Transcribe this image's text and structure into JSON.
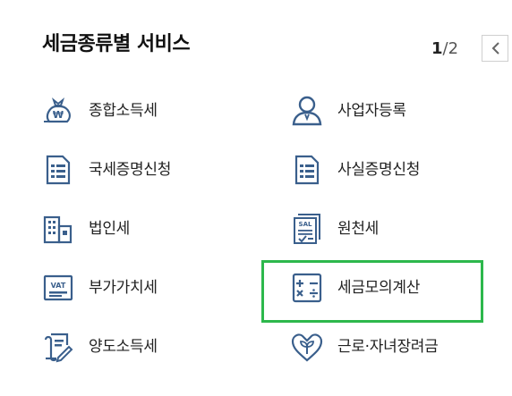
{
  "header": {
    "title": "세금종류별 서비스",
    "pager": {
      "current": "1",
      "separator": "/",
      "total": "2"
    }
  },
  "services": {
    "left": [
      {
        "label": "종합소득세",
        "icon": "money-bag-icon"
      },
      {
        "label": "국세증명신청",
        "icon": "document-icon"
      },
      {
        "label": "법인세",
        "icon": "building-icon"
      },
      {
        "label": "부가가치세",
        "icon": "vat-icon"
      },
      {
        "label": "양도소득세",
        "icon": "document-pen-icon"
      }
    ],
    "right": [
      {
        "label": "사업자등록",
        "icon": "person-icon"
      },
      {
        "label": "사실증명신청",
        "icon": "document-icon"
      },
      {
        "label": "원천세",
        "icon": "salary-slip-icon"
      },
      {
        "label": "세금모의계산",
        "icon": "calculator-icon"
      },
      {
        "label": "근로·자녀장려금",
        "icon": "heart-sprout-icon"
      }
    ]
  },
  "colors": {
    "icon": "#3a5f8c",
    "highlight": "#2db84c"
  }
}
